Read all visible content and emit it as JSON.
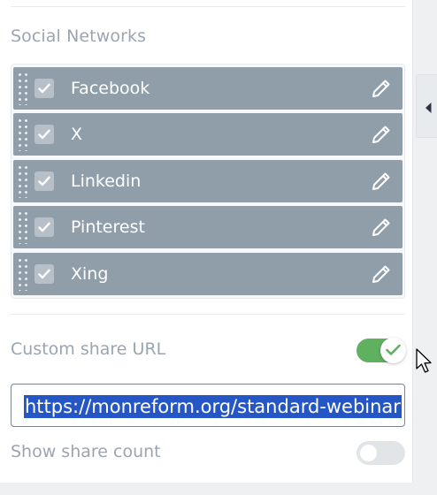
{
  "section": {
    "title": "Social Networks"
  },
  "networks": [
    {
      "label": "Facebook",
      "checked": true
    },
    {
      "label": "X",
      "checked": true
    },
    {
      "label": "Linkedin",
      "checked": true
    },
    {
      "label": "Pinterest",
      "checked": true
    },
    {
      "label": "Xing",
      "checked": true
    }
  ],
  "custom_share_url": {
    "label": "Custom share URL",
    "enabled": true,
    "value": "https://monreform.org/standard-webinar"
  },
  "show_share_count": {
    "label": "Show share count",
    "enabled": false
  },
  "colors": {
    "item_bg": "#909eaa",
    "toggle_on": "#5fb05f",
    "selection": "#2457c5",
    "label_text": "#9aa5b1"
  },
  "icons": {
    "drag": "drag-handle-icon",
    "check": "checkmark-icon",
    "edit": "pencil-icon",
    "panel_toggle": "caret-left-icon",
    "cursor": "mouse-pointer-icon"
  }
}
